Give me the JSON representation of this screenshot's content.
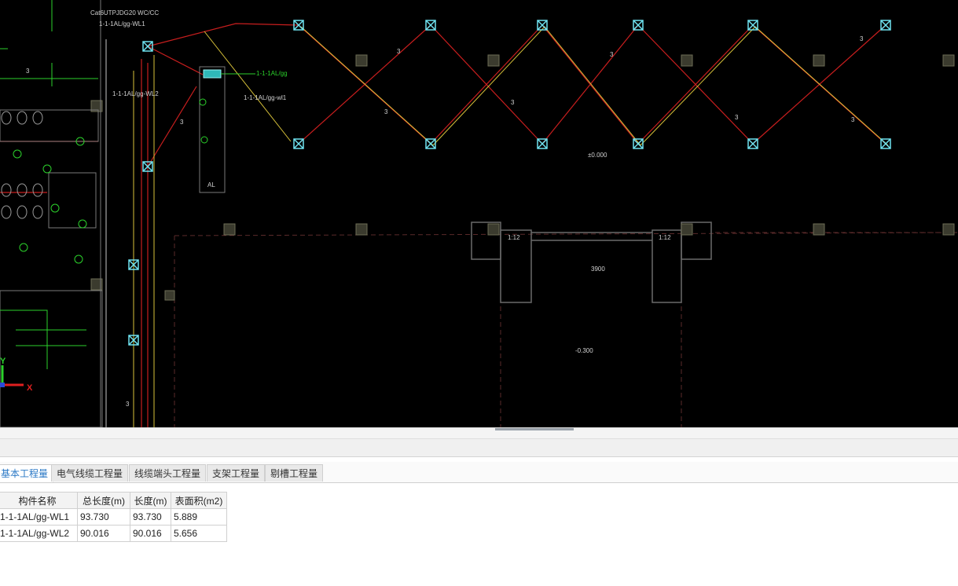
{
  "cad": {
    "top_note": "Cat6UTPJDG20 WC/CC",
    "labels": {
      "wl_a": "1-1-1AL/gg",
      "wl_b": "1-1-1AL/gg-WL2",
      "wl_c": "1-1-1AL/gg-WL1",
      "wl_d": "1-1-1AL/gg-wl1",
      "cable_count": "3",
      "elev_zero": "±0.000",
      "elev_neg": "-0.300",
      "ramp_a": "1:12",
      "ramp_b": "1:12",
      "dim": "3900",
      "room": "AL"
    },
    "axis": {
      "x": "X",
      "y": "Y"
    },
    "colors": {
      "background": "#000000",
      "wire_red": "#d12020",
      "wire_yellow": "#d8c23a",
      "fixture": "#6fe3f0",
      "column": "#4a4a3a",
      "green": "#2bd12b"
    }
  },
  "tabs": [
    {
      "label": "基本工程量",
      "active": true
    },
    {
      "label": "电气线缆工程量",
      "active": false
    },
    {
      "label": "线缆端头工程量",
      "active": false
    },
    {
      "label": "支架工程量",
      "active": false
    },
    {
      "label": "剔槽工程量",
      "active": false
    }
  ],
  "table": {
    "headers": [
      "构件名称",
      "总长度(m)",
      "长度(m)",
      "表面积(m2)"
    ],
    "rows": [
      [
        "1-1-1AL/gg-WL1",
        "93.730",
        "93.730",
        "5.889"
      ],
      [
        "1-1-1AL/gg-WL2",
        "90.016",
        "90.016",
        "5.656"
      ]
    ]
  }
}
